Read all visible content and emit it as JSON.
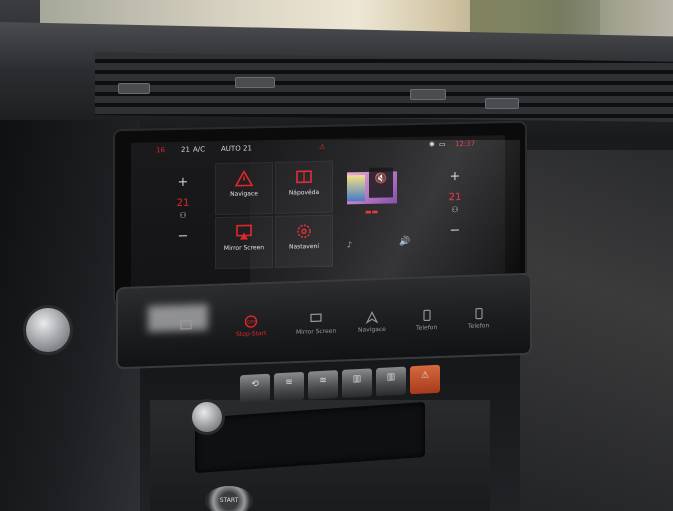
{
  "status_bar": {
    "left_temp": "16",
    "fan": "21",
    "ac": "A/C",
    "auto": "AUTO",
    "right_fan": "21",
    "time": "12:37"
  },
  "climate_left": {
    "plus": "+",
    "temp": "21",
    "minus": "−",
    "seat": "⚇"
  },
  "climate_right": {
    "plus": "+",
    "temp": "21",
    "minus": "−",
    "seat": "⚇"
  },
  "tiles": [
    {
      "label": "Navigace",
      "icon": "warning-triangle-icon"
    },
    {
      "label": "Nápověda",
      "icon": "help-book-icon"
    },
    {
      "label": "Mirror Screen",
      "icon": "mirror-screen-icon"
    },
    {
      "label": "Nastavení",
      "icon": "settings-gear-icon"
    }
  ],
  "media": {
    "mute_icon": "🔇",
    "note": "♪",
    "volume": "🔊"
  },
  "touchbar": {
    "items": [
      {
        "label": "",
        "icon": "home-icon",
        "active": false
      },
      {
        "label": "Stop-Start",
        "icon": "stop-start-icon",
        "active": true
      },
      {
        "label": "Mirror Screen",
        "icon": "mirror-screen-icon",
        "active": false
      },
      {
        "label": "Navigace",
        "icon": "navigation-icon",
        "active": false
      },
      {
        "label": "Telefon",
        "icon": "phone-icon",
        "active": false
      },
      {
        "label": "Telefon",
        "icon": "phone-icon",
        "active": false
      }
    ]
  },
  "hardware_buttons": [
    "⟲",
    "≋",
    "≋",
    "▥",
    "▥",
    "⚠"
  ],
  "start_button": "START",
  "colors": {
    "accent": "#e0262a",
    "screen_bg": "#1a1a1c",
    "tile_bg": "#202022"
  }
}
